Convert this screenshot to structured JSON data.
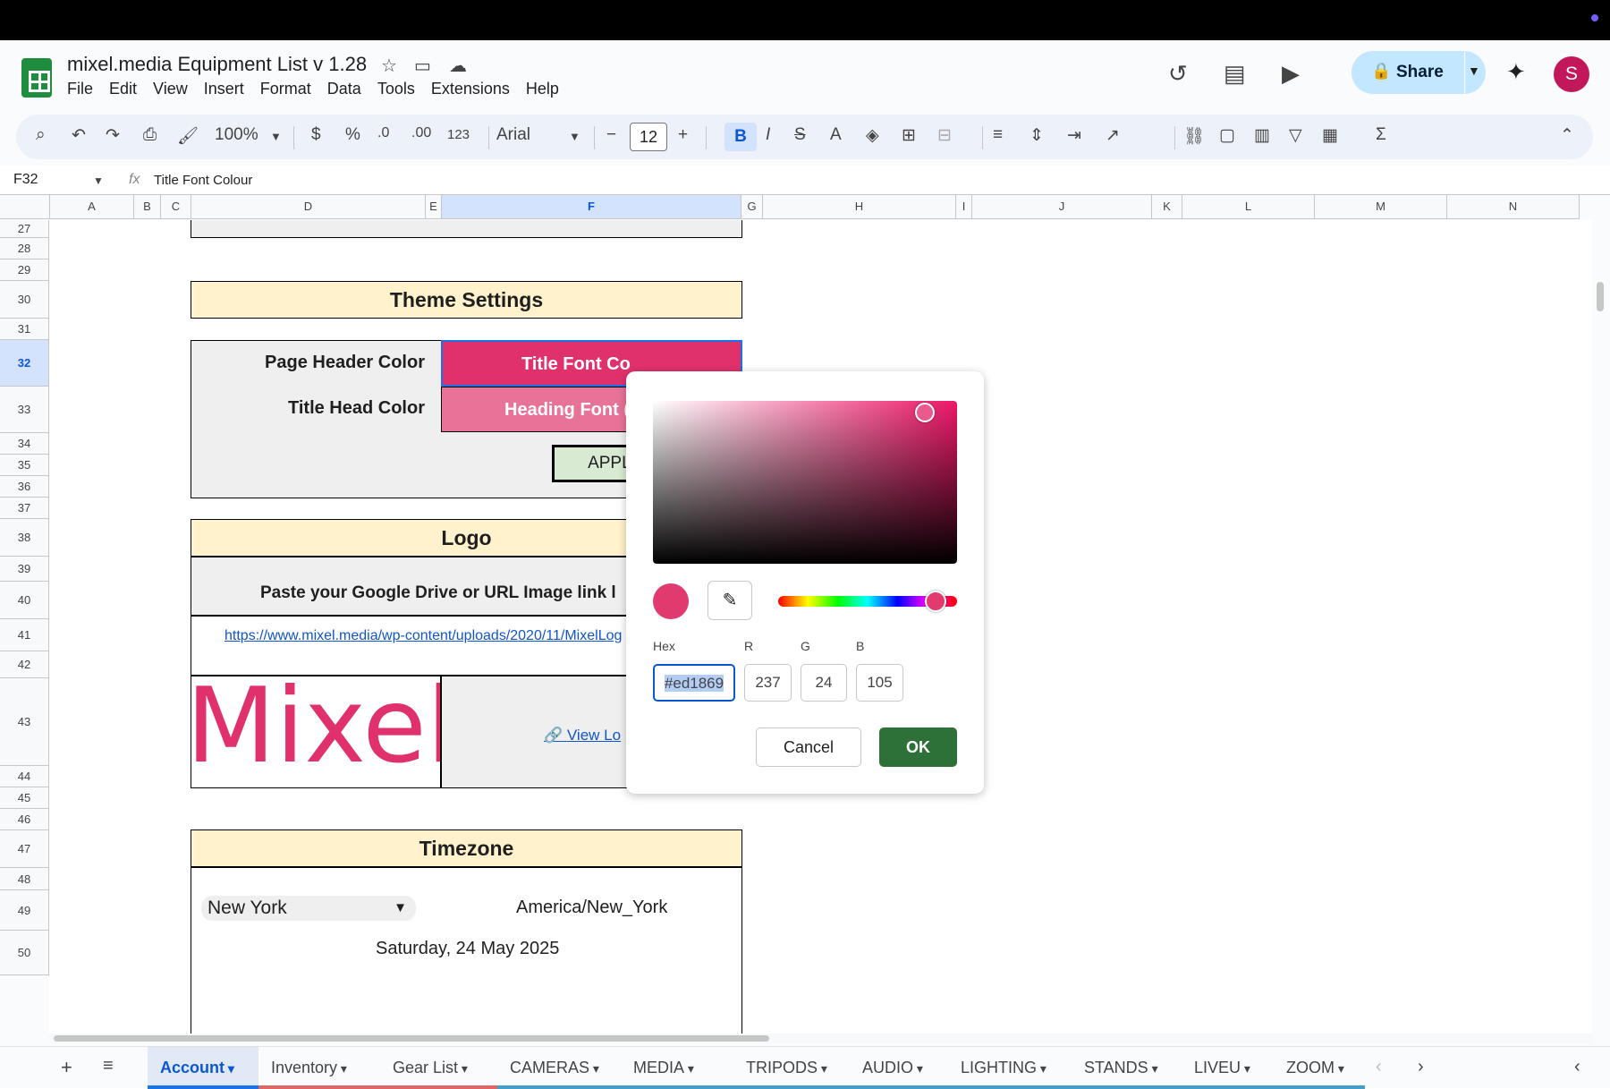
{
  "header": {
    "title": "mixel.media Equipment List v 1.28",
    "menus": [
      "File",
      "Edit",
      "View",
      "Insert",
      "Format",
      "Data",
      "Tools",
      "Extensions",
      "Help"
    ],
    "share_label": "Share",
    "avatar_letter": "S"
  },
  "toolbar": {
    "zoom": "100%",
    "currency": "$",
    "percent": "%",
    "dec_minus": ".0",
    "dec_plus": ".00",
    "number_format": "123",
    "font": "Arial",
    "font_size": "12",
    "bold": "B",
    "italic": "I",
    "strike": "S",
    "text_color": "A",
    "sum": "Σ"
  },
  "formula_bar": {
    "cell_ref": "F32",
    "fx": "fx",
    "content": "Title Font Colour"
  },
  "columns": [
    "A",
    "B",
    "C",
    "D",
    "E",
    "F",
    "G",
    "H",
    "I",
    "J",
    "K",
    "L",
    "M",
    "N"
  ],
  "rows": [
    "27",
    "28",
    "29",
    "30",
    "31",
    "32",
    "33",
    "34",
    "35",
    "36",
    "37",
    "38",
    "39",
    "40",
    "41",
    "42",
    "43",
    "44",
    "45",
    "46",
    "47",
    "48",
    "49",
    "50"
  ],
  "sheet": {
    "theme_header": "Theme Settings",
    "page_header_label": "Page Header Color",
    "title_head_label": "Title Head Color",
    "title_font_cell": "Title Font Co",
    "heading_font_cell": "Heading Font (",
    "apply_button": "APPLY",
    "logo_header": "Logo",
    "logo_instructions": "Paste your Google Drive or URL Image link l",
    "logo_url": "https://www.mixel.media/wp-content/uploads/2020/11/MixelLog",
    "logo_text": "Mixel",
    "view_logo": "View Lo",
    "timezone_header": "Timezone",
    "timezone_select": "New York",
    "timezone_value": "America/New_York",
    "date": "Saturday, 24 May 2025"
  },
  "color_picker": {
    "hex_label": "Hex",
    "r_label": "R",
    "g_label": "G",
    "b_label": "B",
    "hex_value": "#ed1869",
    "r_value": "237",
    "g_value": "24",
    "b_value": "105",
    "cancel_label": "Cancel",
    "ok_label": "OK",
    "selected_color": "#ed1869"
  },
  "sheet_tabs": [
    {
      "label": "Account",
      "color": "#1a73e8",
      "active": true
    },
    {
      "label": "Inventory",
      "color": "#e06666"
    },
    {
      "label": "Gear List",
      "color": "#e06666"
    },
    {
      "label": "CAMERAS",
      "color": "#45a0c9"
    },
    {
      "label": "MEDIA",
      "color": "#45a0c9"
    },
    {
      "label": "TRIPODS",
      "color": "#45a0c9"
    },
    {
      "label": "AUDIO",
      "color": "#45a0c9"
    },
    {
      "label": "LIGHTING",
      "color": "#45a0c9"
    },
    {
      "label": "STANDS",
      "color": "#45a0c9"
    },
    {
      "label": "LIVEU",
      "color": "#45a0c9"
    },
    {
      "label": "ZOOM",
      "color": "#45a0c9"
    }
  ]
}
